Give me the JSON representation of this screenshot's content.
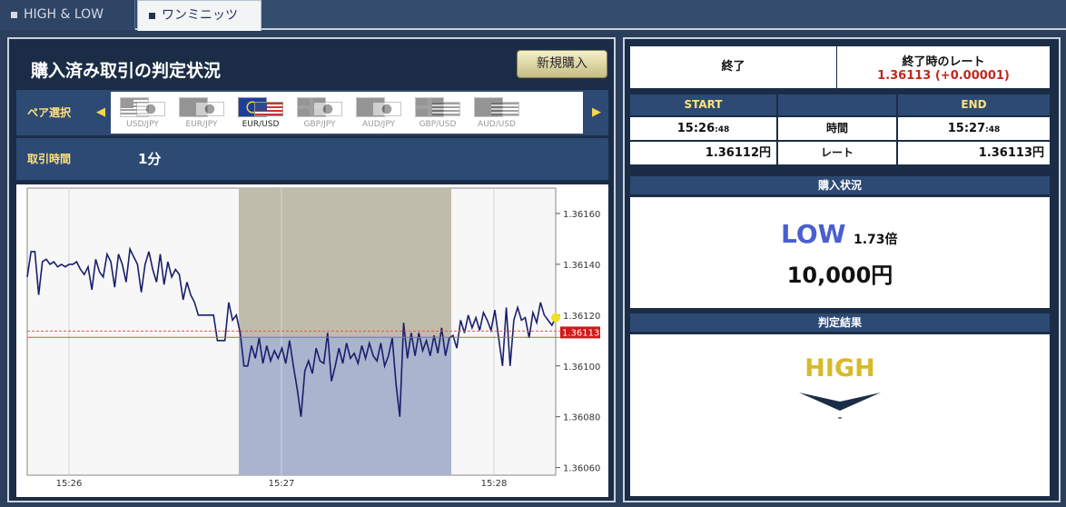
{
  "tabs": [
    {
      "label": "HIGH & LOW"
    },
    {
      "label": "ワンミニッツ"
    }
  ],
  "left": {
    "title": "購入済み取引の判定状況",
    "new_button": "新規購入",
    "pair_label": "ペア選択",
    "pairs": [
      {
        "label": "USD/JPY"
      },
      {
        "label": "EUR/JPY"
      },
      {
        "label": "EUR/USD"
      },
      {
        "label": "GBP/JPY"
      },
      {
        "label": "AUD/JPY"
      },
      {
        "label": "GBP/USD"
      },
      {
        "label": "AUD/USD"
      }
    ],
    "arrow_left": "◀",
    "arrow_right": "▶",
    "time_label": "取引時間",
    "time_value": "1分"
  },
  "chart_data": {
    "type": "line",
    "x_ticks": [
      "15:26",
      "15:27",
      "15:28"
    ],
    "y_ticks": [
      "1.36160",
      "1.36140",
      "1.36120",
      "1.36100",
      "1.36080",
      "1.36060"
    ],
    "ylim": [
      1.36057,
      1.3617
    ],
    "current_rate_label": "1.36113",
    "entry_rate": 1.36112,
    "current_rate": 1.36113,
    "trade_window": {
      "start": "15:26:48",
      "end": "15:27:48"
    },
    "series": [
      {
        "values": [
          1.36135,
          1.36145,
          1.36145,
          1.36128,
          1.36141,
          1.36142,
          1.3614,
          1.36141,
          1.36139,
          1.3614,
          1.36139,
          1.3614,
          1.3614,
          1.36141,
          1.36138,
          1.36136,
          1.36139,
          1.3613,
          1.36142,
          1.36137,
          1.36135,
          1.36144,
          1.36141,
          1.36131,
          1.36144,
          1.3614,
          1.36133,
          1.36146,
          1.36143,
          1.3614,
          1.36129,
          1.3614,
          1.36145,
          1.36138,
          1.36133,
          1.36144,
          1.36132,
          1.36141,
          1.36135,
          1.36138,
          1.36136,
          1.36126,
          1.36133,
          1.36128,
          1.36125,
          1.3612,
          1.3612,
          1.3612,
          1.3612,
          1.3612,
          1.3611,
          1.3611,
          1.3611,
          1.36125,
          1.36118,
          1.3612,
          1.36113,
          1.361,
          1.361,
          1.36108,
          1.36103,
          1.36111,
          1.36101,
          1.36108,
          1.36102,
          1.36106,
          1.36103,
          1.36107,
          1.36101,
          1.3611,
          1.361,
          1.36091,
          1.3608,
          1.36098,
          1.36102,
          1.36097,
          1.36107,
          1.36102,
          1.36101,
          1.36113,
          1.36094,
          1.361,
          1.36107,
          1.36101,
          1.36109,
          1.36103,
          1.36105,
          1.36101,
          1.36108,
          1.36103,
          1.36109,
          1.36104,
          1.36102,
          1.36109,
          1.361,
          1.36104,
          1.36111,
          1.36093,
          1.3608,
          1.36117,
          1.36103,
          1.36113,
          1.36104,
          1.36113,
          1.36106,
          1.3611,
          1.36104,
          1.36112,
          1.36105,
          1.36115,
          1.36104,
          1.36111,
          1.36112,
          1.36107,
          1.36118,
          1.36113,
          1.3612,
          1.36115,
          1.36119,
          1.36114,
          1.36121,
          1.36118,
          1.36114,
          1.36122,
          1.36111,
          1.361,
          1.36123,
          1.361,
          1.36118,
          1.36123,
          1.36118,
          1.36119,
          1.36111,
          1.36121,
          1.36117,
          1.36125,
          1.3612,
          1.36118,
          1.36116,
          1.36119
        ]
      }
    ]
  },
  "right": {
    "status": "終了",
    "end_rate_title": "終了時のレート",
    "end_rate_value": "1.36113 (+0.00001)",
    "table": {
      "start_hdr": "START",
      "end_hdr": "END",
      "time_label": "時間",
      "rate_label": "レート",
      "start_time": "15:26",
      "start_sec": ":48",
      "end_time": "15:27",
      "end_sec": ":48",
      "start_rate": "1.36112円",
      "end_rate": "1.36113円"
    },
    "purchase_hdr": "購入状況",
    "direction": "LOW",
    "multiplier": "1.73倍",
    "amount": "10,000円",
    "result_hdr": "判定結果",
    "result": "HIGH",
    "result_sub": "-"
  },
  "colors": {
    "navy": "#1b2d46",
    "header_blue": "#2d4a74",
    "accent_yellow": "#ffe27a",
    "line": "#1a1f6b",
    "low_blue": "#4a5fcf",
    "high_gold": "#d8b92a",
    "rate_red": "#c0281e"
  }
}
